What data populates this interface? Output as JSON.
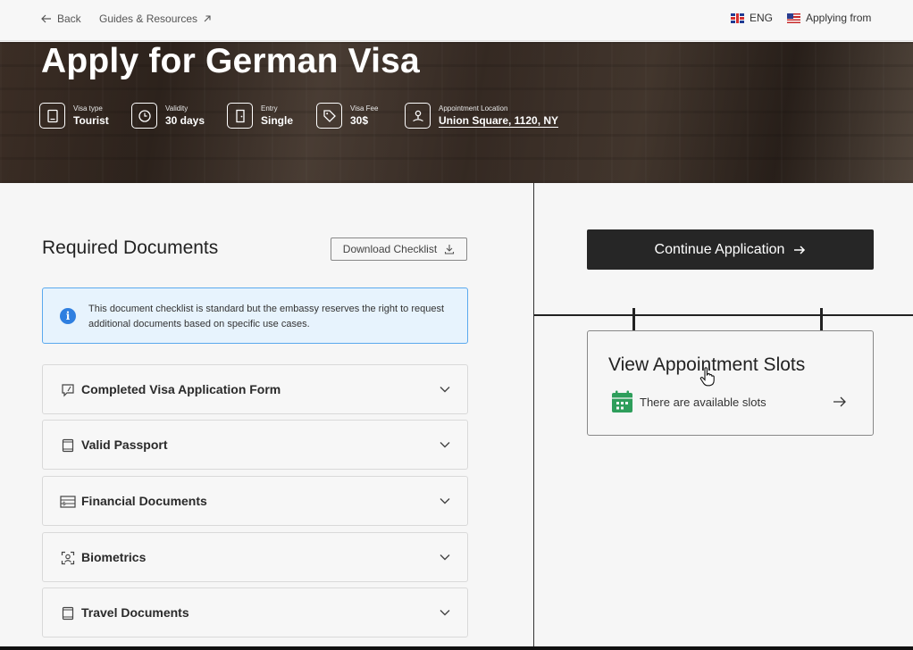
{
  "nav": {
    "back_label": "Back",
    "guides_label": "Guides & Resources",
    "lang_label": "ENG",
    "applying_from_label": "Applying from"
  },
  "hero": {
    "title": "Apply for German Visa",
    "facts": [
      {
        "label": "Visa type",
        "value": "Tourist",
        "icon": "passport-icon"
      },
      {
        "label": "Validity",
        "value": "30 days",
        "icon": "clock-icon"
      },
      {
        "label": "Entry",
        "value": "Single",
        "icon": "door-icon"
      },
      {
        "label": "Visa Fee",
        "value": "30$",
        "icon": "tag-icon"
      },
      {
        "label": "Appointment Location",
        "value": "Union Square, 1120, NY",
        "icon": "location-pin-icon"
      }
    ]
  },
  "documents": {
    "title": "Required Documents",
    "download_label": "Download Checklist",
    "notice": "This document checklist is standard but the embassy reserves the right to request additional documents based on specific use cases.",
    "items": [
      {
        "label": "Completed Visa Application Form",
        "icon": "form-icon"
      },
      {
        "label": "Valid Passport",
        "icon": "passport-icon"
      },
      {
        "label": "Financial Documents",
        "icon": "money-icon"
      },
      {
        "label": "Biometrics",
        "icon": "face-scan-icon"
      },
      {
        "label": "Travel Documents",
        "icon": "travel-doc-icon"
      }
    ]
  },
  "sidebar": {
    "continue_label": "Continue Application",
    "slots_title": "View Appointment Slots",
    "slots_status": "There are available slots"
  },
  "colors": {
    "primary_dark": "#262626",
    "info_bg": "#e7f3fd",
    "info_border": "#5aa9ee",
    "info_icon": "#2f7fe0",
    "calendar_green": "#2e9e5b"
  }
}
